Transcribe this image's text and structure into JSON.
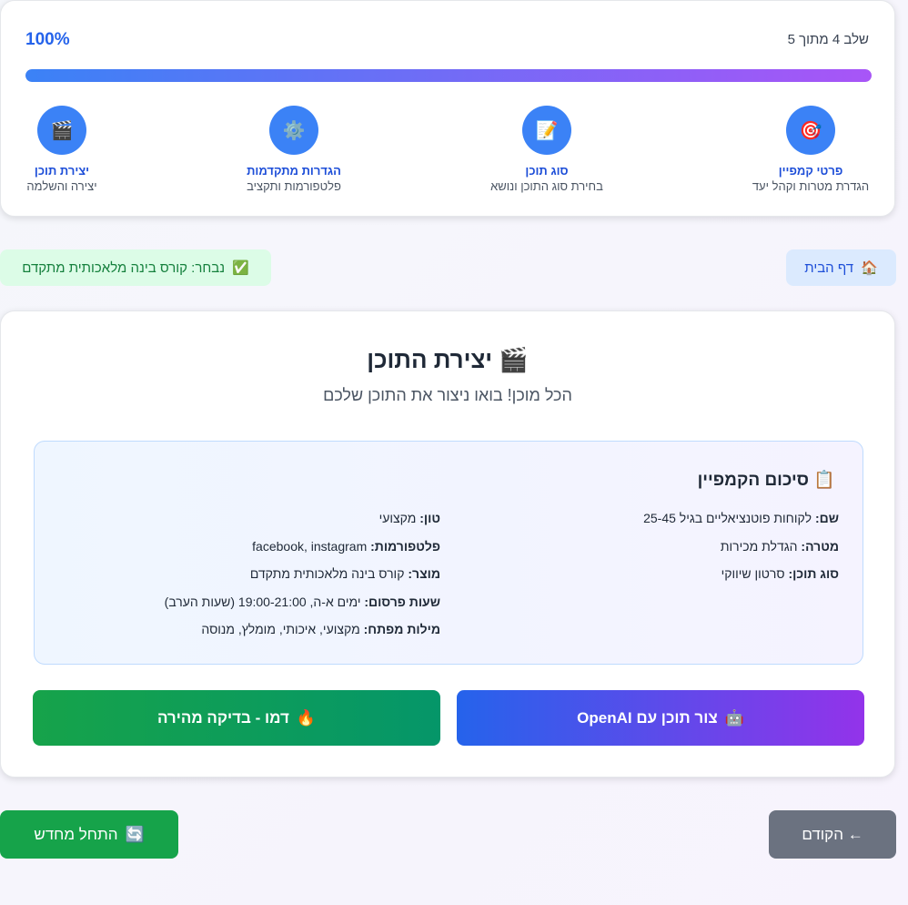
{
  "progress": {
    "percent_label": "100%",
    "percent": 100,
    "step_label": "שלב 4 מתוך 5"
  },
  "steps": [
    {
      "icon": "🎯",
      "title": "פרטי קמפיין",
      "desc": "הגדרת מטרות וקהל יעד"
    },
    {
      "icon": "📝",
      "title": "סוג תוכן",
      "desc": "בחירת סוג התוכן ונושא"
    },
    {
      "icon": "⚙️",
      "title": "הגדרות מתקדמות",
      "desc": "פלטפורמות ותקציב"
    },
    {
      "icon": "🎬",
      "title": "יצירת תוכן",
      "desc": "יצירה והשלמה"
    }
  ],
  "nav": {
    "home_icon": "🏠",
    "home_label": "דף הבית",
    "selected_icon": "✅",
    "selected_label": "נבחר: קורס בינה מלאכותית מתקדם"
  },
  "main": {
    "title_icon": "🎬",
    "title": "יצירת התוכן",
    "subtitle": "הכל מוכן! בואו ניצור את התוכן שלכם",
    "summary": {
      "icon": "📋",
      "title": "סיכום הקמפיין",
      "right": [
        {
          "k": "שם:",
          "v": "לקוחות פוטנציאליים בגיל 25-45"
        },
        {
          "k": "מטרה:",
          "v": "הגדלת מכירות"
        },
        {
          "k": "סוג תוכן:",
          "v": "סרטון שיווקי"
        }
      ],
      "left": [
        {
          "k": "טון:",
          "v": "מקצועי"
        },
        {
          "k": "פלטפורמות:",
          "v": "facebook, instagram"
        },
        {
          "k": "מוצר:",
          "v": "קורס בינה מלאכותית מתקדם"
        },
        {
          "k": "שעות פרסום:",
          "v": "ימים א-ה, 19:00-21:00 (שעות הערב)"
        },
        {
          "k": "מילות מפתח:",
          "v": "מקצועי, איכותי, מומלץ, מנוסה"
        }
      ]
    },
    "openai_icon": "🤖",
    "openai_label": "צור תוכן עם OpenAI",
    "demo_icon": "🔥",
    "demo_label": "דמו - בדיקה מהירה"
  },
  "footer": {
    "prev_label": "← הקודם",
    "restart_icon": "🔄",
    "restart_label": "התחל מחדש"
  }
}
